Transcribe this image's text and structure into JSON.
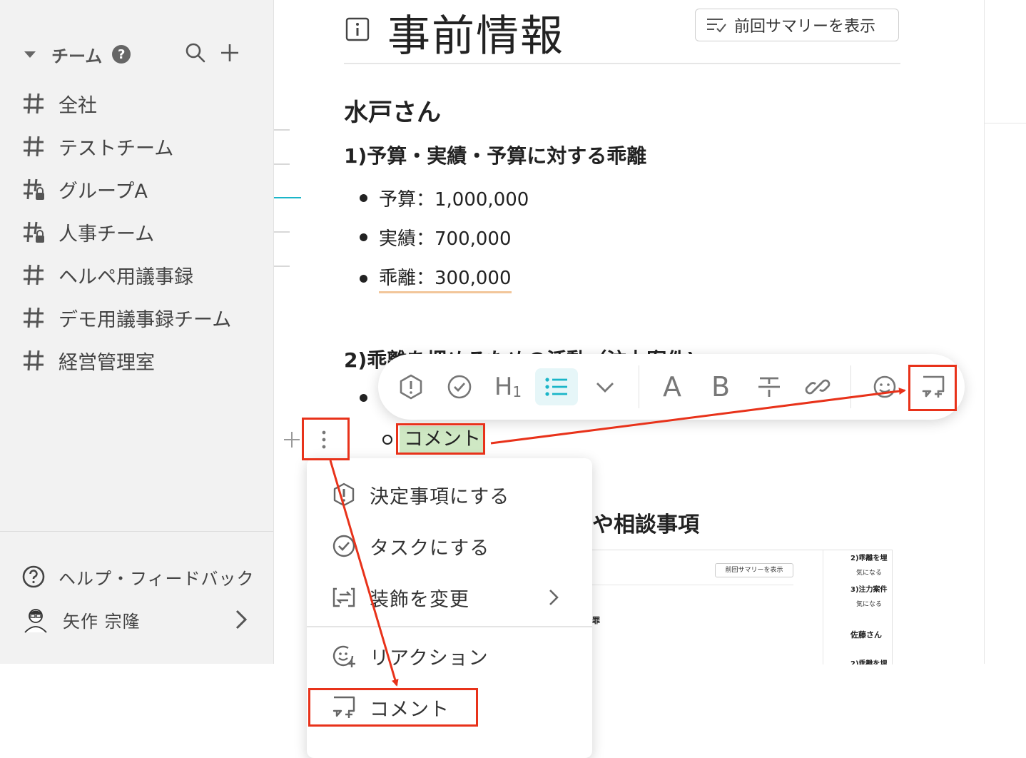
{
  "sidebar": {
    "team_label": "チーム",
    "help_badge": "?",
    "channels": [
      {
        "label": "全社",
        "icon": "hash-icon"
      },
      {
        "label": "テストチーム",
        "icon": "hash-icon"
      },
      {
        "label": "グループA",
        "icon": "hash-lock-icon"
      },
      {
        "label": "人事チーム",
        "icon": "hash-lock-icon"
      },
      {
        "label": "ヘルペ用議事録",
        "icon": "hash-icon"
      },
      {
        "label": "デモ用議事録チーム",
        "icon": "hash-icon"
      },
      {
        "label": "経営管理室",
        "icon": "hash-icon"
      }
    ],
    "help_feedback": "ヘルプ・フィードバック",
    "user_name": "矢作 宗隆"
  },
  "document": {
    "title": "事前情報",
    "summary_button": "前回サマリーを表示",
    "person_heading": "水戸さん",
    "section1_heading": "1)予算・実績・予算に対する乖離",
    "section1_items": [
      "予算：1,000,000",
      "実績：700,000",
      "乖離：300,000"
    ],
    "section2_heading": "2)乖離を埋めるための活動（注力案件)",
    "selected_comment_text": "コメント",
    "section3_heading_visible": "や相談事項"
  },
  "thumbnail": {
    "summary_button": "前回サマリーを表示",
    "lines": [
      "2)乖離を埋",
      "気になる",
      "3)注力案件",
      "気になる",
      "佐藤さん",
      "2)乖離を埋"
    ]
  },
  "context_menu": {
    "items": [
      {
        "label": "決定事項にする",
        "icon": "decision-icon"
      },
      {
        "label": "タスクにする",
        "icon": "task-check-icon"
      },
      {
        "label": "装飾を変更",
        "icon": "convert-icon"
      },
      {
        "label": "リアクション",
        "icon": "reaction-icon"
      },
      {
        "label": "コメント",
        "icon": "comment-add-icon"
      }
    ]
  },
  "toolbar": {
    "heading_label": "H",
    "heading_sub": "1",
    "text_a": "A",
    "text_b": "B"
  },
  "colors": {
    "accent": "#1ab5c8",
    "highlight": "#cfe8c4",
    "annotation_red": "#e8321a"
  }
}
